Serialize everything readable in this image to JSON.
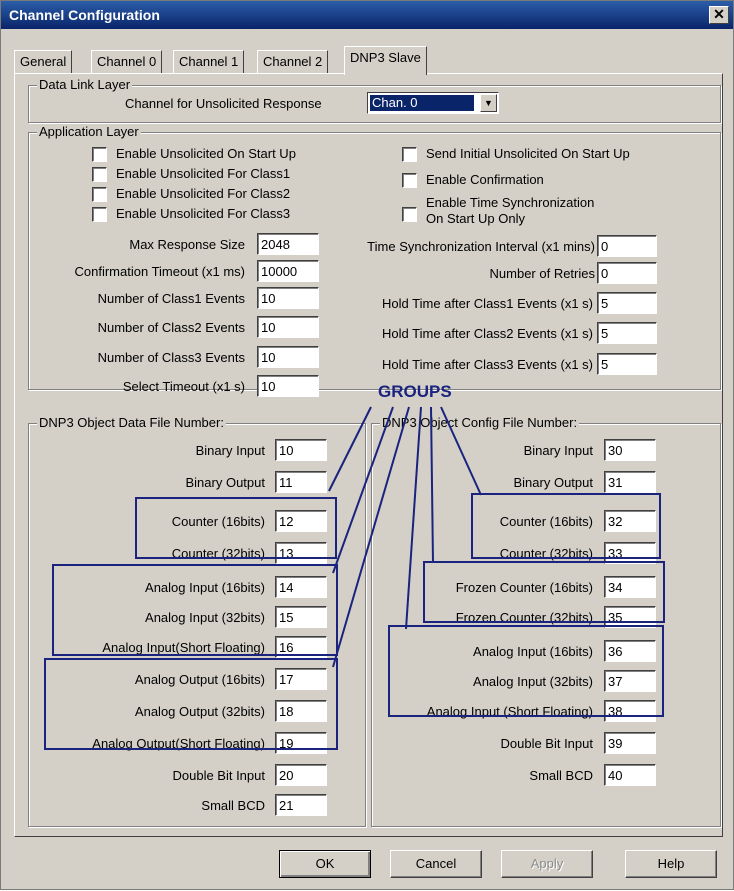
{
  "window": {
    "title": "Channel Configuration",
    "close_label": "✕"
  },
  "tabs": [
    "General",
    "Channel 0",
    "Channel 1",
    "Channel 2",
    "DNP3 Slave"
  ],
  "data_link": {
    "legend": "Data Link Layer",
    "channel_label": "Channel for Unsolicited Response",
    "channel_value": "Chan. 0",
    "dropdown_arrow": "▼"
  },
  "app_layer": {
    "legend": "Application Layer",
    "left_checks": [
      "Enable Unsolicited On Start Up",
      "Enable Unsolicited For Class1",
      "Enable Unsolicited For Class2",
      "Enable Unsolicited For Class3"
    ],
    "right_checks": [
      "Send Initial Unsolicited On Start Up",
      "Enable Confirmation",
      "Enable Time Synchronization",
      "On Start Up Only"
    ],
    "left_fields": [
      {
        "label": "Max Response Size",
        "value": "2048"
      },
      {
        "label": "Confirmation Timeout (x1 ms)",
        "value": "10000"
      },
      {
        "label": "Number of Class1 Events",
        "value": "10"
      },
      {
        "label": "Number of Class2 Events",
        "value": "10"
      },
      {
        "label": "Number of Class3 Events",
        "value": "10"
      },
      {
        "label": "Select Timeout (x1 s)",
        "value": "10"
      }
    ],
    "right_fields": [
      {
        "label": "Time Synchronization Interval (x1 mins)",
        "value": "0"
      },
      {
        "label": "Number of Retries",
        "value": "0"
      },
      {
        "label": "Hold Time after Class1 Events (x1 s)",
        "value": "5"
      },
      {
        "label": "Hold Time after Class2 Events (x1 s)",
        "value": "5"
      },
      {
        "label": "Hold Time after Class3 Events (x1 s)",
        "value": "5"
      }
    ]
  },
  "data_file": {
    "legend": "DNP3 Object Data File Number:",
    "rows": [
      {
        "label": "Binary Input",
        "value": "10"
      },
      {
        "label": "Binary Output",
        "value": "11"
      },
      {
        "label": "Counter (16bits)",
        "value": "12"
      },
      {
        "label": "Counter (32bits)",
        "value": "13"
      },
      {
        "label": "Analog Input (16bits)",
        "value": "14"
      },
      {
        "label": "Analog Input (32bits)",
        "value": "15"
      },
      {
        "label": "Analog Input(Short Floating)",
        "value": "16"
      },
      {
        "label": "Analog Output (16bits)",
        "value": "17"
      },
      {
        "label": "Analog Output (32bits)",
        "value": "18"
      },
      {
        "label": "Analog Output(Short Floating)",
        "value": "19"
      },
      {
        "label": "Double Bit Input",
        "value": "20"
      },
      {
        "label": "Small BCD",
        "value": "21"
      }
    ]
  },
  "config_file": {
    "legend": "DNP3 Object Config File Number:",
    "rows": [
      {
        "label": "Binary Input",
        "value": "30"
      },
      {
        "label": "Binary Output",
        "value": "31"
      },
      {
        "label": "Counter (16bits)",
        "value": "32"
      },
      {
        "label": "Counter (32bits)",
        "value": "33"
      },
      {
        "label": "Frozen Counter (16bits)",
        "value": "34"
      },
      {
        "label": "Frozen Counter (32bits)",
        "value": "35"
      },
      {
        "label": "Analog Input (16bits)",
        "value": "36"
      },
      {
        "label": "Analog Input (32bits)",
        "value": "37"
      },
      {
        "label": "Analog Input (Short Floating)",
        "value": "38"
      },
      {
        "label": "Double Bit Input",
        "value": "39"
      },
      {
        "label": "Small BCD",
        "value": "40"
      }
    ]
  },
  "annotation": {
    "label": "GROUPS",
    "color": "#1a237e"
  },
  "buttons": {
    "ok": "OK",
    "cancel": "Cancel",
    "apply": "Apply",
    "help": "Help"
  }
}
